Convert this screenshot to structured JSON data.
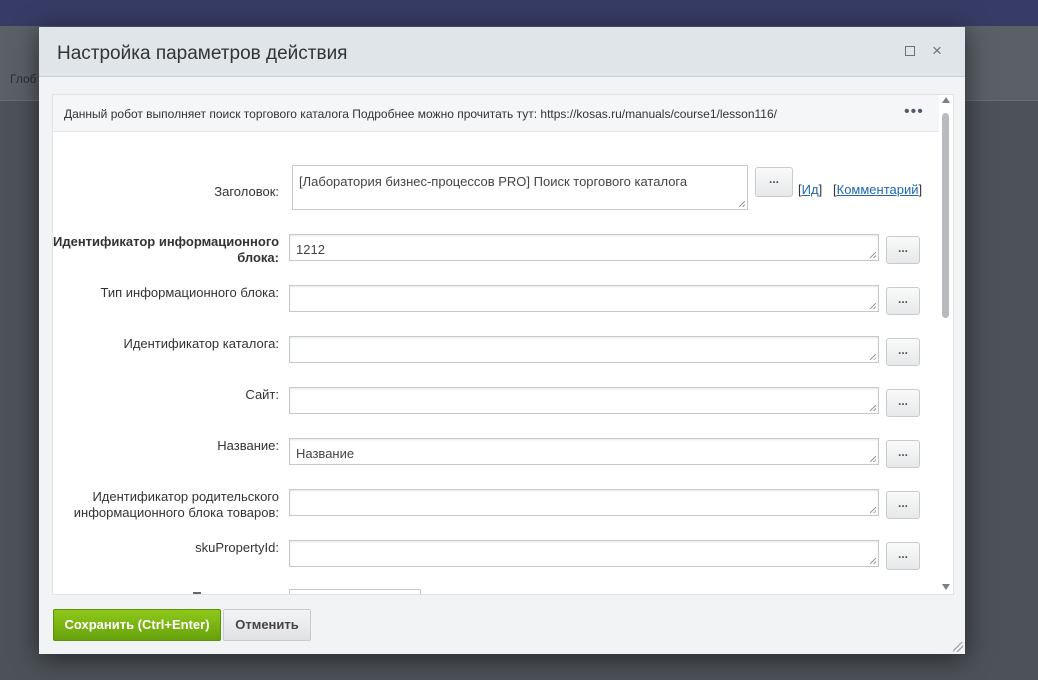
{
  "background": {
    "fragment_text": "Глоб"
  },
  "dialog": {
    "title": "Настройка параметров действия",
    "info_text": "Данный робот выполняет поиск торгового каталога Подробнее можно прочитать тут: https://kosas.ru/manuals/course1/lesson116/",
    "title_field": {
      "label": "Заголовок:",
      "value": "[Лаборатория бизнес-процессов PRO] Поиск торгового каталога",
      "link_id": "Ид",
      "link_comment": "Комментарий"
    },
    "fields": [
      {
        "label": "Идентификатор информационного блока:",
        "value": "1212",
        "bold": true
      },
      {
        "label": "Тип информационного блока:",
        "value": ""
      },
      {
        "label": "Идентификатор каталога:",
        "value": ""
      },
      {
        "label": "Сайт:",
        "value": ""
      },
      {
        "label": "Название:",
        "value": "Название"
      },
      {
        "label": "Идентификатор родительского информационного блока товаров:",
        "value": ""
      },
      {
        "label": "skuPropertyId:",
        "value": ""
      }
    ],
    "dots_label": "...",
    "more_label": "•••",
    "save_label": "Сохранить (Ctrl+Enter)",
    "cancel_label": "Отменить",
    "close_glyph": "×"
  }
}
